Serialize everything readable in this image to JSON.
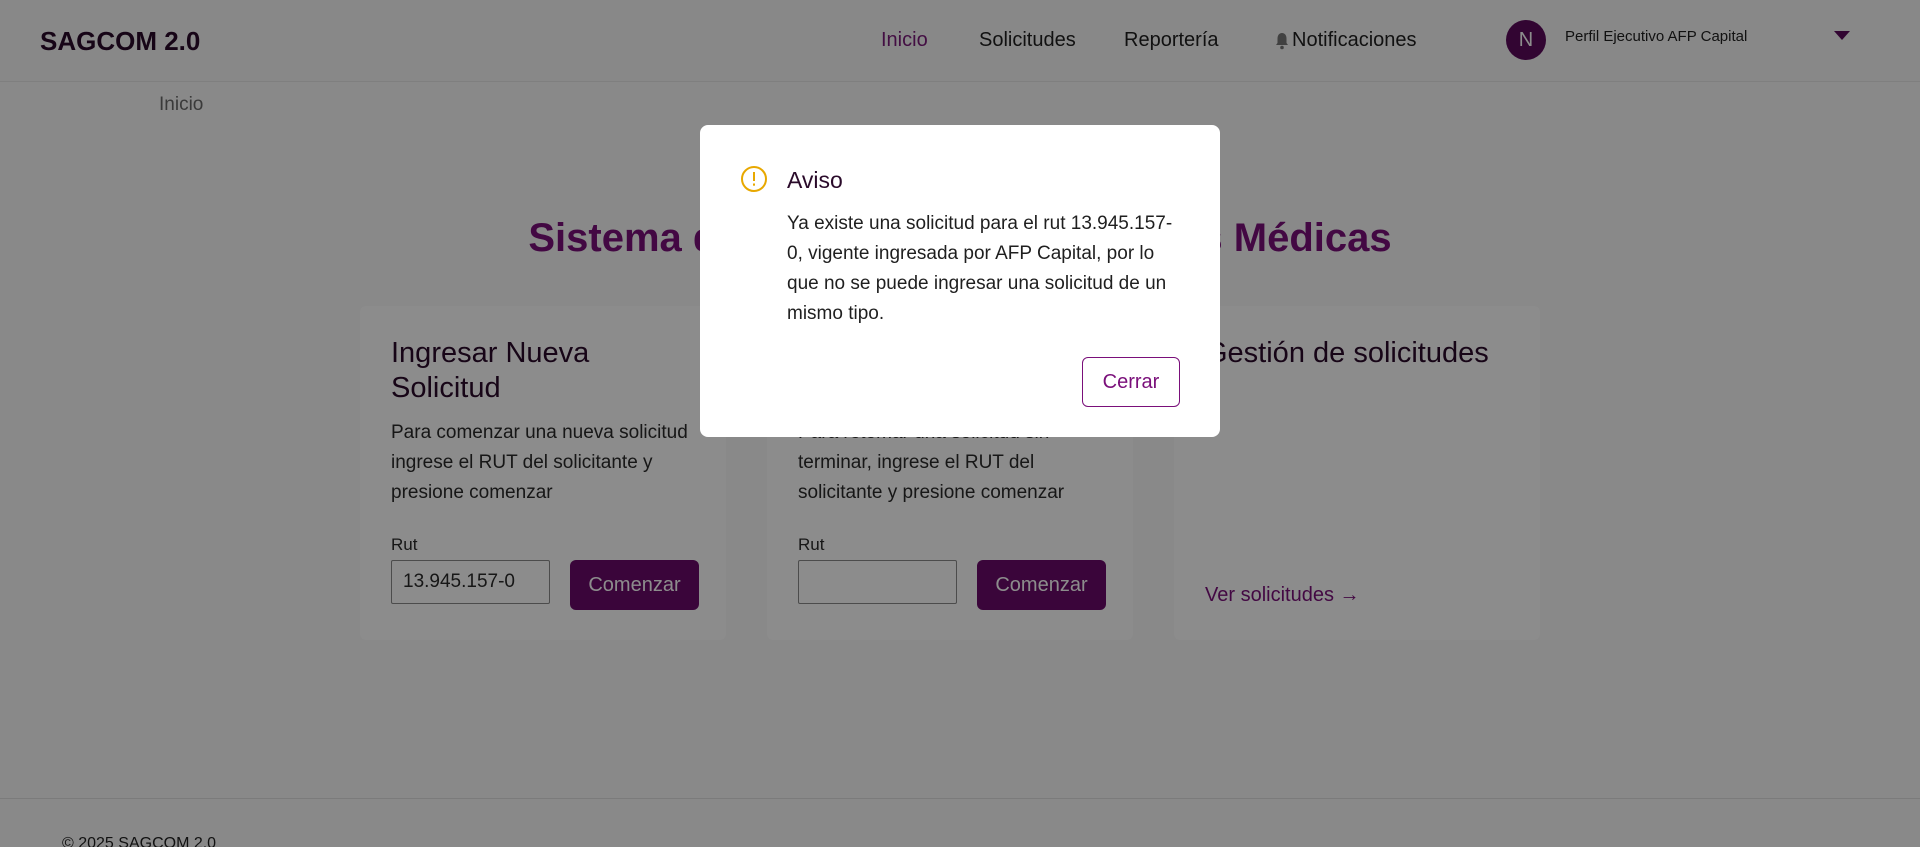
{
  "header": {
    "logo": "SAGCOM 2.0",
    "nav": {
      "inicio": "Inicio",
      "solicitudes": "Solicitudes",
      "reporteria": "Reportería",
      "notificaciones": "Notificaciones"
    },
    "avatar_initial": "N",
    "profile_name": "Perfil Ejecutivo AFP Capital"
  },
  "breadcrumb": "Inicio",
  "main_title": "Sistema de Apelaciones Comisiones Médicas",
  "cards": [
    {
      "title": "Ingresar Nueva Solicitud",
      "description": "Para comenzar una nueva solicitud ingrese el RUT del solicitante y presione comenzar",
      "rut_label": "Rut",
      "rut_value": "13.945.157-0",
      "button": "Comenzar"
    },
    {
      "title": "",
      "description": "Para retomar una solicitud sin terminar, ingrese el RUT del solicitante y presione comenzar",
      "rut_label": "Rut",
      "rut_value": "",
      "button": "Comenzar"
    },
    {
      "title": "Gestión de solicitudes",
      "link": "Ver solicitudes →"
    }
  ],
  "footer": "© 2025 SAGCOM 2.0",
  "modal": {
    "title": "Aviso",
    "body": "Ya existe una solicitud para el rut 13.945.157-0, vigente ingresada por AFP Capital, por lo que no se puede ingresar una solicitud de un mismo tipo.",
    "close_button": "Cerrar",
    "icon": "warning-icon"
  },
  "colors": {
    "brand": "#6a0a6a",
    "accent": "#7a0f7a",
    "warning": "#e8a800"
  }
}
